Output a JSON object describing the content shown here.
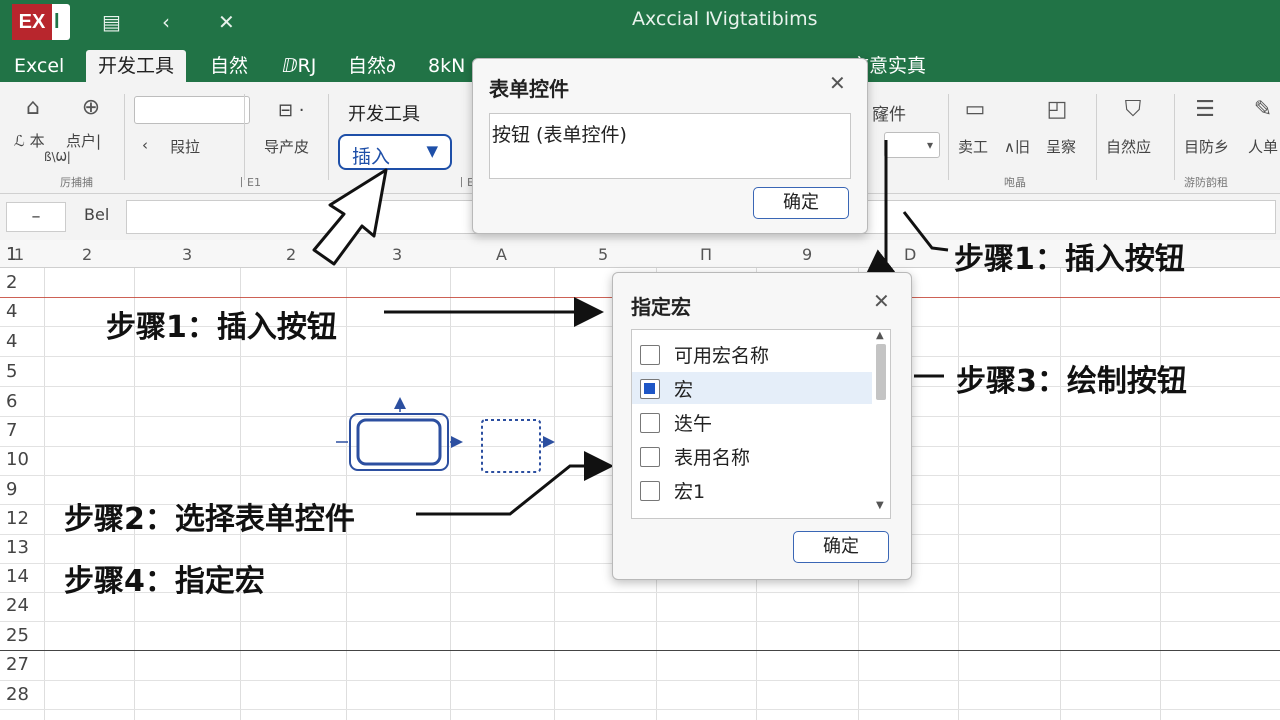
{
  "titlebar": {
    "logo_main": "EX",
    "logo_sub": "l",
    "title": "Axccial Ⅳigtatibims",
    "qat_save": "▤",
    "qat_undo": "‹",
    "qat_close": "✕"
  },
  "tabs": [
    {
      "label": "Excel"
    },
    {
      "label": "开发工具"
    },
    {
      "label": "自然"
    },
    {
      "label": "ⅅRJ"
    },
    {
      "label": "自然∂"
    },
    {
      "label": "8kN"
    },
    {
      "label": "言意实真"
    }
  ],
  "ribbon": {
    "b1": "ℒ 本",
    "b1_sub": "ß\\Ѡ|",
    "b2": "点户|",
    "back_arrow": "‹",
    "b3": "叚拉",
    "b4": "⊟ ·",
    "b4_label": "导产皮",
    "dev_label": "开发工具",
    "insert": "插入",
    "insert_caret": "▼",
    "g1": "厉捕捕",
    "g2": "丨E1",
    "g3": "丨E",
    "r_label1": "窿件",
    "r_label2": "卖工",
    "r_label3": "∧旧",
    "r_label4": "呈察",
    "r_label5": "自然应",
    "r_label6": "目防乡",
    "r_label7": "人单",
    "g4": "咆晶",
    "g5": "游防韵租"
  },
  "formula": {
    "namebox": "–",
    "fx": "Bel"
  },
  "grid": {
    "cols": [
      "1",
      "2",
      "3",
      "2",
      "3",
      "A",
      "5",
      "Π",
      "9",
      "D"
    ],
    "rows": [
      "1",
      "2",
      "4",
      "4",
      "5",
      "6",
      "7",
      "10",
      "9",
      "12",
      "13",
      "14",
      "24",
      "25",
      "27",
      "28"
    ]
  },
  "form_dialog": {
    "title": "表单控件",
    "value": "按钮 (表单控件)",
    "ok": "确定"
  },
  "macro_dialog": {
    "title": "指定宏",
    "items": [
      {
        "label": "可用宏名称",
        "checked": false
      },
      {
        "label": "宏",
        "checked": true
      },
      {
        "label": "迭午",
        "checked": false
      },
      {
        "label": "表用名称",
        "checked": false
      },
      {
        "label": "宏1",
        "checked": false
      }
    ],
    "ok": "确定"
  },
  "annotations": {
    "step1_top": "步骤1：插入按钮",
    "step1_left": "步骤1：插入按钮",
    "step3": "步骤3：绘制按钮",
    "step2": "步骤2：选择表单控件",
    "step4": "步骤4：指定宏"
  },
  "colors": {
    "accent": "#217346",
    "brand_red": "#b8262d",
    "insert_blue": "#1e4fa8"
  }
}
